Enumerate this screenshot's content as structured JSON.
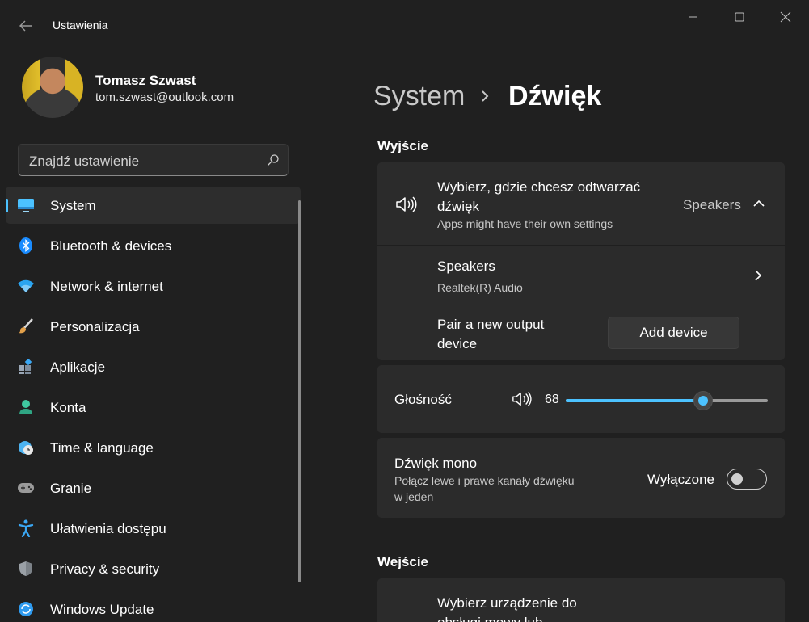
{
  "window": {
    "title": "Ustawienia"
  },
  "profile": {
    "name": "Tomasz Szwast",
    "email": "tom.szwast@outlook.com"
  },
  "search": {
    "placeholder": "Znajdź ustawienie"
  },
  "sidebar": {
    "active_index": 0,
    "items": [
      {
        "label": "System",
        "icon": "monitor-icon",
        "color": "#4cc2ff"
      },
      {
        "label": "Bluetooth & devices",
        "icon": "bluetooth-icon",
        "color": "#1a8cff"
      },
      {
        "label": "Network & internet",
        "icon": "wifi-icon",
        "color": "#2aa4f0"
      },
      {
        "label": "Personalizacja",
        "icon": "brush-icon",
        "color": "#e2a04a"
      },
      {
        "label": "Aplikacje",
        "icon": "apps-icon",
        "color": "#9aa7b6"
      },
      {
        "label": "Konta",
        "icon": "person-icon",
        "color": "#3fc8a0"
      },
      {
        "label": "Time & language",
        "icon": "globe-clock-icon",
        "color": "#4cb2f0"
      },
      {
        "label": "Granie",
        "icon": "gamepad-icon",
        "color": "#9a9a9a"
      },
      {
        "label": "Ułatwienia dostępu",
        "icon": "accessibility-icon",
        "color": "#3aa8f5"
      },
      {
        "label": "Privacy & security",
        "icon": "shield-icon",
        "color": "#9aa0a6"
      },
      {
        "label": "Windows Update",
        "icon": "update-icon",
        "color": "#2e9bf0"
      }
    ]
  },
  "breadcrumb": {
    "parent": "System",
    "current": "Dźwięk"
  },
  "output": {
    "section_title": "Wyjście",
    "choose": {
      "title_line1": "Wybierz, gdzie chcesz odtwarzać",
      "title_line2": "dźwięk",
      "subtitle": "Apps might have their own settings",
      "selected": "Speakers"
    },
    "device": {
      "name": "Speakers",
      "driver": "Realtek(R) Audio"
    },
    "pair": {
      "label_line1": "Pair a new output",
      "label_line2": "device",
      "button": "Add device"
    }
  },
  "volume": {
    "label": "Głośność",
    "value": 68,
    "value_text": "68"
  },
  "mono": {
    "title": "Dźwięk mono",
    "desc_line1": "Połącz lewe i prawe kanały dźwięku",
    "desc_line2": "w jeden",
    "state_text": "Wyłączone",
    "on": false
  },
  "input": {
    "section_title": "Wejście",
    "choose_line1": "Wybierz urządzenie do",
    "choose_line2": "obsługi mowy lub"
  },
  "colors": {
    "accent": "#4cc2ff",
    "background": "#202020",
    "card": "#2b2b2b"
  }
}
